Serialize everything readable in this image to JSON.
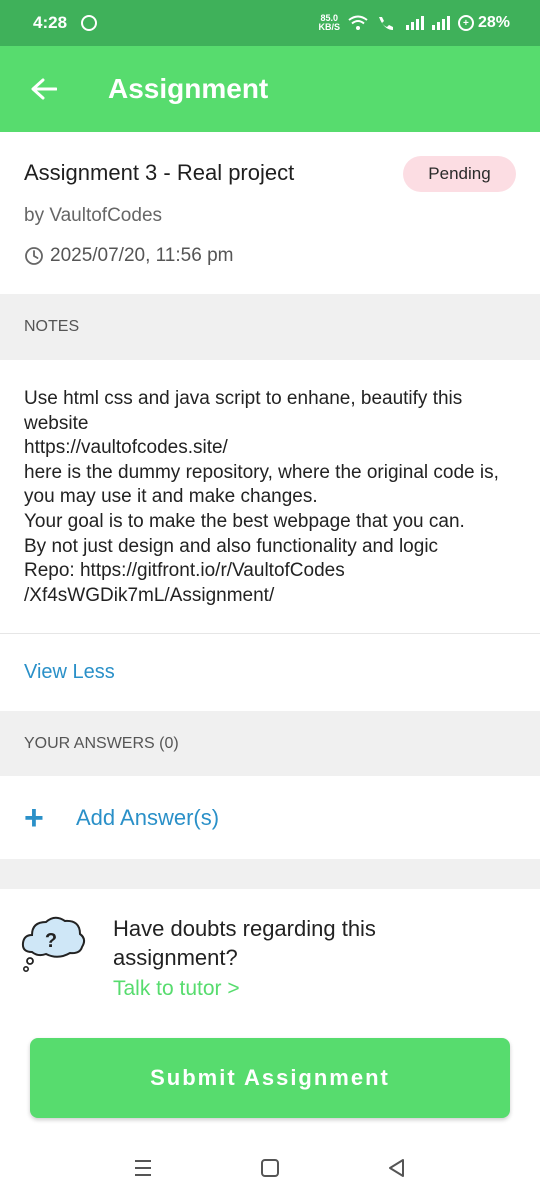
{
  "status_bar": {
    "time": "4:28",
    "net_speed_value": "85.0",
    "net_speed_unit": "KB/S",
    "battery": "28%"
  },
  "app_bar": {
    "title": "Assignment",
    "back_icon": "arrow-left-icon"
  },
  "assignment": {
    "title": "Assignment 3 - Real project",
    "status": "Pending",
    "author": "by VaultofCodes",
    "due": "2025/07/20, 11:56 pm"
  },
  "notes": {
    "header": "NOTES",
    "body": "Use html css and java script to enhane, beautify this website\nhttps://vaultofcodes.site/\nhere is the dummy repository, where the original code is, you may use it and make changes.\nYour goal is to make the best webpage that you can.\nBy not just design and also functionality and logic\nRepo: https://gitfront.io/r/VaultofCodes\n/Xf4sWGDik7mL/Assignment/",
    "toggle_label": "View Less"
  },
  "answers": {
    "header": "YOUR ANSWERS (0)",
    "add_label": "Add Answer(s)"
  },
  "doubts": {
    "question": "Have doubts regarding this assignment?",
    "link": "Talk to tutor >"
  },
  "submit_label": "Submit Assignment",
  "colors": {
    "accent": "#57dc6e",
    "status_bar": "#3fb15a",
    "link": "#2a90c8",
    "badge_bg": "#fcdde3"
  }
}
